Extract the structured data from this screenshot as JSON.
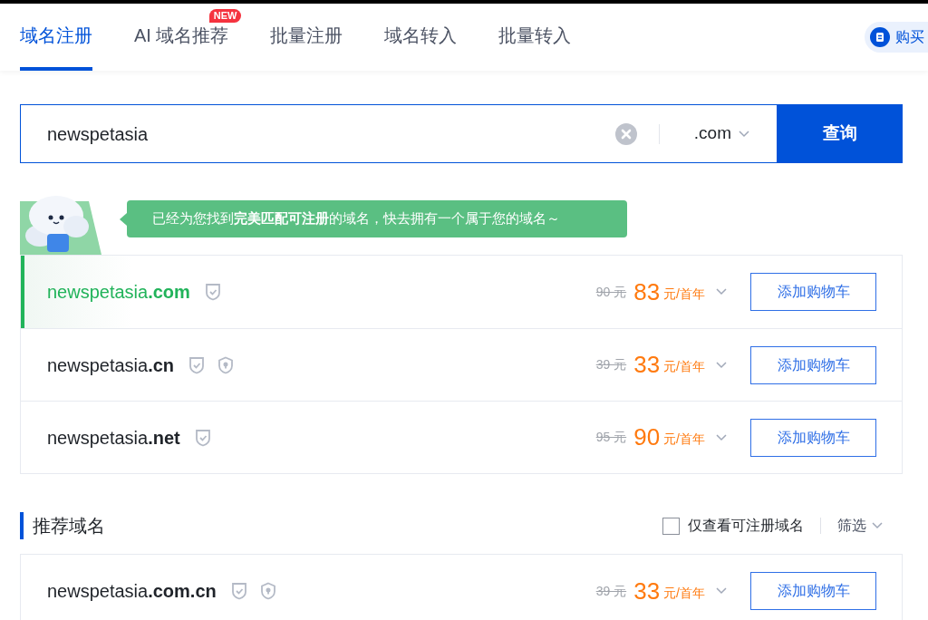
{
  "tabs": [
    {
      "label": "域名注册",
      "selected": true
    },
    {
      "label": "AI 域名推荐",
      "selected": false,
      "badge": "NEW"
    },
    {
      "label": "批量注册",
      "selected": false
    },
    {
      "label": "域名转入",
      "selected": false
    },
    {
      "label": "批量转入",
      "selected": false
    }
  ],
  "header_button": {
    "label": "购买"
  },
  "search": {
    "value": "newspetasia",
    "suffix": ".com",
    "button": "查询"
  },
  "notice": "已经为您找到 **完美匹配可注册** 的域名，快去拥有一个属于您的域名～",
  "results": [
    {
      "name": "newspetasia",
      "tld": ".com",
      "matched": true,
      "badges": [
        {
          "kind": "check"
        }
      ],
      "old_price": "90 元",
      "price": "83",
      "unit": "元/首年",
      "button": "添加购物车"
    },
    {
      "name": "newspetasia",
      "tld": ".cn",
      "matched": false,
      "badges": [
        {
          "kind": "check"
        },
        {
          "kind": "lock"
        }
      ],
      "old_price": "39 元",
      "price": "33",
      "unit": "元/首年",
      "button": "添加购物车"
    },
    {
      "name": "newspetasia",
      "tld": ".net",
      "matched": false,
      "badges": [
        {
          "kind": "check"
        }
      ],
      "old_price": "95 元",
      "price": "90",
      "unit": "元/首年",
      "button": "添加购物车"
    }
  ],
  "recommended": {
    "title": "推荐域名",
    "filter_checkbox": {
      "label": "仅查看可注册域名",
      "checked": false
    },
    "filter": "筛选",
    "rows": [
      {
        "name": "newspetasia",
        "tld": ".com.cn",
        "matched": false,
        "badges": [
          {
            "kind": "check"
          },
          {
            "kind": "lock"
          }
        ],
        "old_price": "39 元",
        "price": "33",
        "unit": "元/首年",
        "button": "添加购物车"
      }
    ]
  }
}
